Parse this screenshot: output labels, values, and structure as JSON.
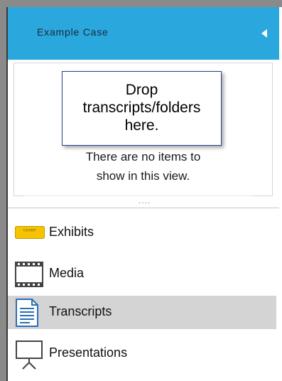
{
  "header": {
    "title": "Example Case",
    "accent_color": "#2aa7dc"
  },
  "view": {
    "empty_message_line1": "There are no items to",
    "empty_message_line2": "show in this view."
  },
  "tooltip": {
    "line1": "Drop",
    "line2": "transcripts/folders",
    "line3": "here."
  },
  "nav": {
    "items": [
      {
        "label": "Exhibits",
        "icon": "exhibit-icon",
        "icon_text": "EXHIBIT",
        "selected": false
      },
      {
        "label": "Media",
        "icon": "film-icon",
        "selected": false
      },
      {
        "label": "Transcripts",
        "icon": "document-icon",
        "selected": true
      },
      {
        "label": "Presentations",
        "icon": "presentation-icon",
        "selected": false
      }
    ]
  }
}
